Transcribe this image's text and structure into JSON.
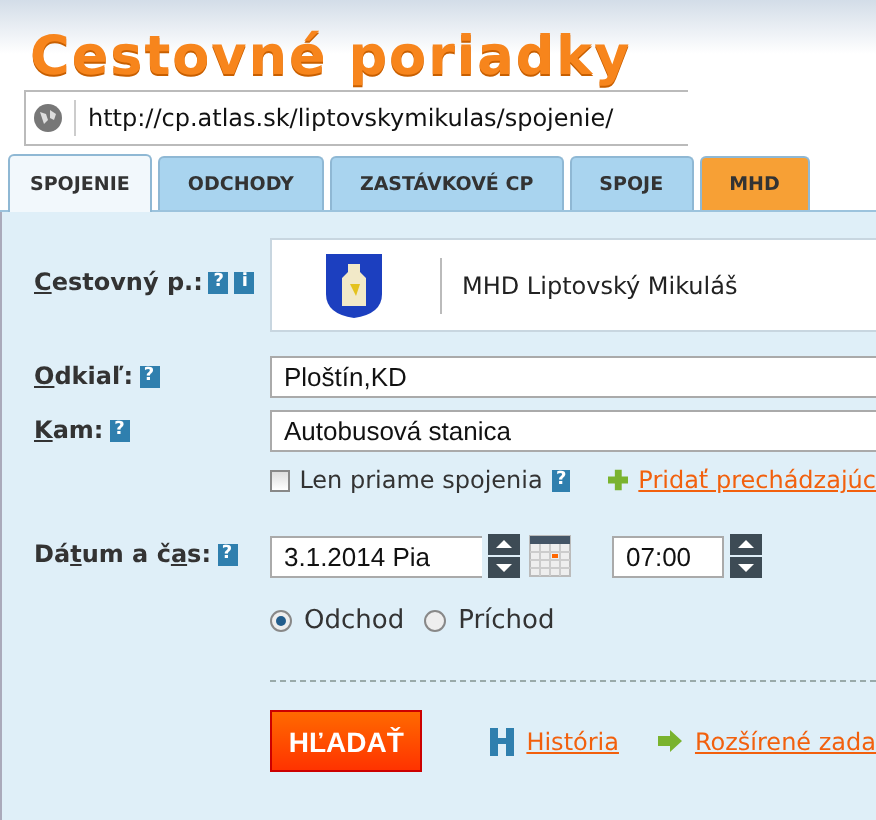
{
  "header": {
    "title": "Cestovné poriadky"
  },
  "address_bar": {
    "url": "http://cp.atlas.sk/liptovskymikulas/spojenie/"
  },
  "tabs": [
    {
      "label": "SPOJENIE",
      "selected": true,
      "color": "#f2f8fc"
    },
    {
      "label": "ODCHODY",
      "selected": false,
      "color": "#a9d4ef"
    },
    {
      "label": "ZASTÁVKOVÉ CP",
      "selected": false,
      "color": "#a9d4ef"
    },
    {
      "label": "SPOJE",
      "selected": false,
      "color": "#a9d4ef"
    },
    {
      "label": "MHD",
      "selected": false,
      "color": "#f7a035"
    }
  ],
  "form": {
    "timetable": {
      "label_parts": [
        {
          "text": "C",
          "underline": true
        },
        {
          "text": "estovný p.:",
          "underline": false
        }
      ],
      "help": "?",
      "info": "i",
      "value": "MHD Liptovský Mikuláš"
    },
    "from": {
      "label_parts": [
        {
          "text": "O",
          "underline": true
        },
        {
          "text": "dkiaľ:",
          "underline": false
        }
      ],
      "help": "?",
      "value": "Ploštín,KD"
    },
    "to": {
      "label_parts": [
        {
          "text": "K",
          "underline": true
        },
        {
          "text": "am:",
          "underline": false
        }
      ],
      "help": "?",
      "value": "Autobusová stanica"
    },
    "direct_only": {
      "label": "Len priame spojenia",
      "checked": false,
      "help": "?"
    },
    "add_via": {
      "label": "Pridať prechádzajúc"
    },
    "datetime": {
      "label_parts": [
        {
          "text": "Dá",
          "underline": false
        },
        {
          "text": "t",
          "underline": true
        },
        {
          "text": "um a č",
          "underline": false
        },
        {
          "text": "a",
          "underline": true
        },
        {
          "text": "s:",
          "underline": false
        }
      ],
      "help": "?",
      "date": "3.1.2014 Pia",
      "time": "07:00"
    },
    "mode": [
      {
        "label": "Odchod",
        "selected": true
      },
      {
        "label": "Príchod",
        "selected": false
      }
    ],
    "search_button": "HĽADAŤ",
    "links": [
      {
        "label": "História",
        "kind": "history"
      },
      {
        "label": "Rozšírené zada",
        "kind": "advanced"
      }
    ]
  }
}
